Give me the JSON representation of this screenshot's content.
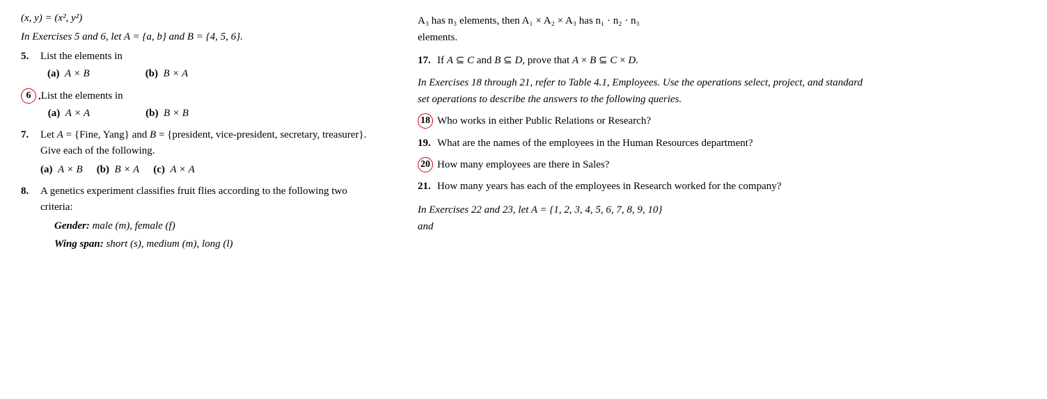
{
  "left": {
    "header_line": "(x, y) = (x², y²)",
    "exercises_intro": "In Exercises 5 and 6, let A = {a, b} and B = {4, 5, 6}.",
    "ex5_label": "5.",
    "ex5_text": "List the elements in",
    "ex5a_label": "(a)",
    "ex5a_math": "A × B",
    "ex5b_label": "(b)",
    "ex5b_math": "B × A",
    "ex6_num": "6",
    "ex6_text": "List the elements in",
    "ex6a_label": "(a)",
    "ex6a_math": "A × A",
    "ex6b_label": "(b)",
    "ex6b_math": "B × B",
    "ex7_label": "7.",
    "ex7_text_1": "Let A",
    "ex7_eq1": "=",
    "ex7_set1": "{Fine, Yang}",
    "ex7_and": "and",
    "ex7_B": "B",
    "ex7_eq2": "=",
    "ex7_set2": "{president, vice-president, secretary, treasurer}.",
    "ex7_suffix": "Give each of the follow-ing.",
    "ex7a_label": "(a)",
    "ex7a_math": "A × B",
    "ex7b_label": "(b)",
    "ex7b_math": "B × A",
    "ex7c_label": "(c)",
    "ex7c_math": "A × A",
    "ex8_label": "8.",
    "ex8_text": "A genetics experiment classifies fruit flies according to the following two criteria:",
    "ex8_gender_label": "Gender:",
    "ex8_gender_text": "male (m), female (f)",
    "ex8_wing_label": "Wing span:",
    "ex8_wing_text": "short (s), medium (m), long (l)"
  },
  "right": {
    "top_line1": "A₃ has n₃ elements, then A₁ × A₂ × A₃ has n₁ · n₂ · n₃",
    "top_line2": "elements.",
    "ex17_label": "17.",
    "ex17_text": "If A ⊆ C and B ⊆ D, prove that A × B ⊆ C × D.",
    "ex_intro_18_21": "In Exercises 18 through 21, refer to Table 4.1, Employees. Use the operations select, project, and standard set operations to describe the answers to the following queries.",
    "ex18_num": "18",
    "ex18_text": "Who works in either Public Relations or Research?",
    "ex19_label": "19.",
    "ex19_text": "What are the names of the employees in the Human Resources department?",
    "ex20_num": "20",
    "ex20_text": "How many employees are there in Sales?",
    "ex21_label": "21.",
    "ex21_text": "How many years has each of the employees in Research worked for the company?",
    "ex_intro_22_23": "In Exercises 22 and 23, let A = {1, 2, 3, 4, 5, 6, 7, 8, 9, 10}",
    "ex_intro_22_23_end": "and"
  }
}
